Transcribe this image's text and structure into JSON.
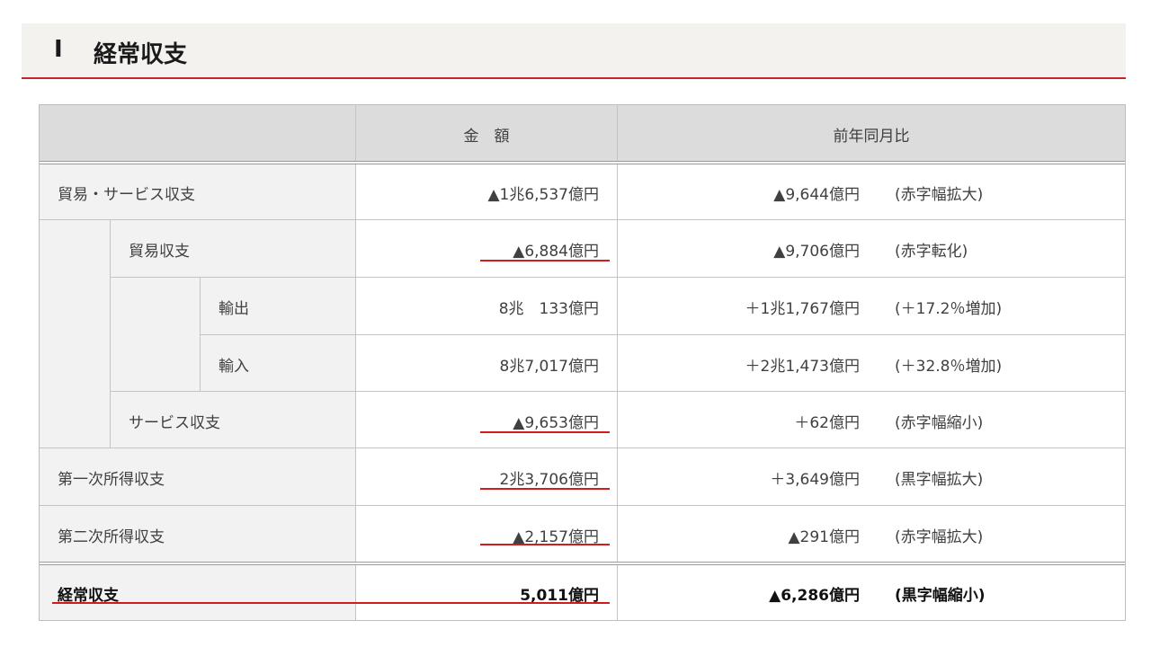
{
  "header": {
    "numeral": "Ⅰ",
    "title": "経常収支"
  },
  "table": {
    "columns": {
      "amount": "金　額",
      "yoy": "前年同月比"
    },
    "rows": [
      {
        "label": "貿易・サービス収支",
        "amount": "▲1兆6,537億円",
        "yoy": "▲9,644億円",
        "note": "(赤字幅拡大)"
      },
      {
        "label": "貿易収支",
        "amount": "▲6,884億円",
        "yoy": "▲9,706億円",
        "note": "(赤字転化)"
      },
      {
        "label": "輸出",
        "amount": "8兆　133億円",
        "yoy": "＋1兆1,767億円",
        "note": "(＋17.2％増加)"
      },
      {
        "label": "輸入",
        "amount": "8兆7,017億円",
        "yoy": "＋2兆1,473億円",
        "note": "(＋32.8％増加)"
      },
      {
        "label": "サービス収支",
        "amount": "▲9,653億円",
        "yoy": "＋62億円",
        "note": "(赤字幅縮小)"
      },
      {
        "label": "第一次所得収支",
        "amount": "2兆3,706億円",
        "yoy": "＋3,649億円",
        "note": "(黒字幅拡大)"
      },
      {
        "label": "第二次所得収支",
        "amount": "▲2,157億円",
        "yoy": "▲291億円",
        "note": "(赤字幅拡大)"
      },
      {
        "label": "経常収支",
        "amount": "5,011億円",
        "yoy": "▲6,286億円",
        "note": "(黒字幅縮小)"
      }
    ]
  },
  "colors": {
    "accent": "#c0272d",
    "underline": "#d21b1b",
    "header_fill": "#dcdcdc",
    "label_fill": "#f2f2f2"
  }
}
